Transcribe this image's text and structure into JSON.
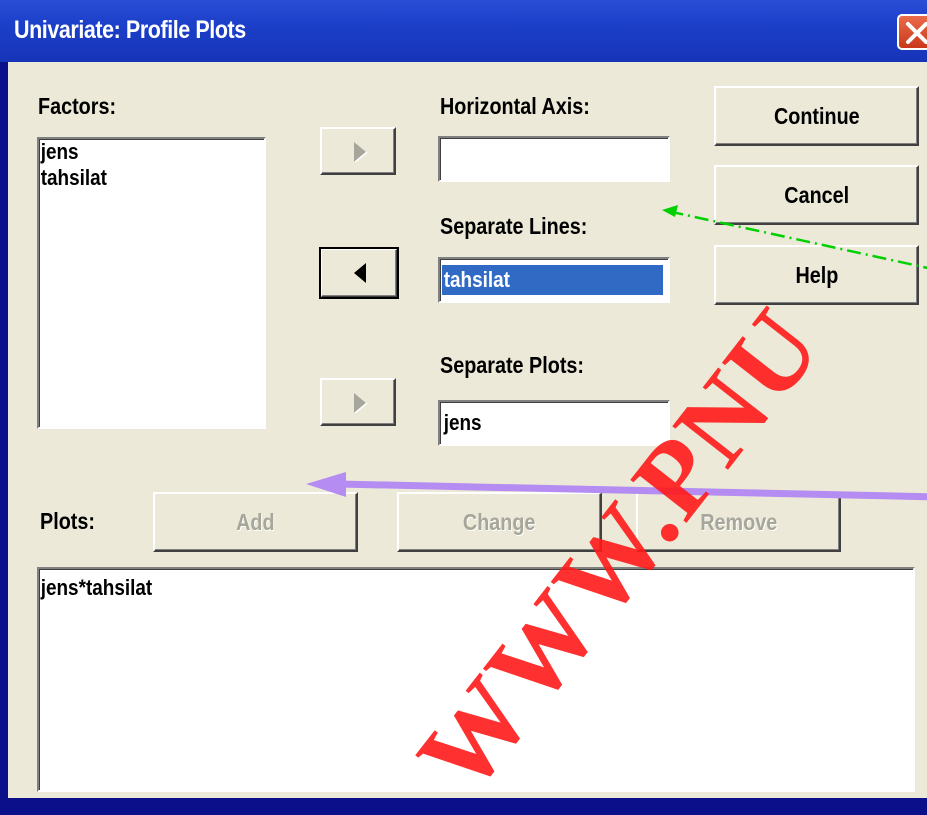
{
  "window": {
    "title": "Univariate: Profile Plots"
  },
  "factors": {
    "label": "Factors:",
    "items": [
      "jens",
      "tahsilat"
    ]
  },
  "horizontal_axis": {
    "label": "Horizontal Axis:",
    "value": ""
  },
  "separate_lines": {
    "label": "Separate Lines:",
    "value": "tahsilat"
  },
  "separate_plots": {
    "label": "Separate Plots:",
    "value": "jens"
  },
  "buttons": {
    "continue": "Continue",
    "cancel": "Cancel",
    "help": "Help",
    "add": "Add",
    "change": "Change",
    "remove": "Remove"
  },
  "plots": {
    "label": "Plots:",
    "items": [
      "jens*tahsilat"
    ]
  },
  "watermark": "WWW.PNU",
  "icons": {
    "close": "close-x-icon",
    "move_right": "triangle-right-icon",
    "move_left": "triangle-left-icon"
  },
  "colors": {
    "frame": "#0b0f8a",
    "titlebar": "#1c3fc9",
    "dialog_face": "#ece9d8",
    "selection": "#316ac5",
    "close_button": "#d9502e",
    "watermark": "#ff0000",
    "green_arrow": "#00d000",
    "violet_arrow": "#b48cf2"
  }
}
